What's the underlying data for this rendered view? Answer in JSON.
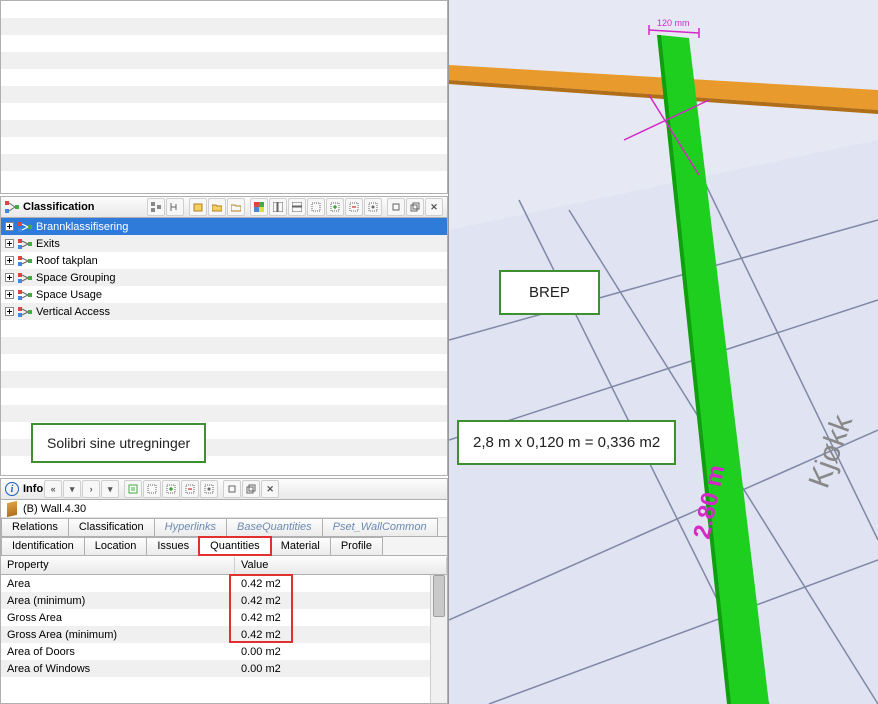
{
  "classification": {
    "title": "Classification",
    "items": [
      {
        "label": "Brannklassifisering",
        "selected": true
      },
      {
        "label": "Exits"
      },
      {
        "label": "Roof takplan"
      },
      {
        "label": "Space Grouping"
      },
      {
        "label": "Space Usage"
      },
      {
        "label": "Vertical Access"
      }
    ]
  },
  "callout_left": "Solibri sine utregninger",
  "info": {
    "title": "Info",
    "object": "(B) Wall.4.30",
    "tabs_row1": [
      {
        "label": "Relations"
      },
      {
        "label": "Classification"
      },
      {
        "label": "Hyperlinks",
        "disabled": true
      },
      {
        "label": "BaseQuantities",
        "disabled": true
      },
      {
        "label": "Pset_WallCommon",
        "disabled": true
      }
    ],
    "tabs_row2": [
      {
        "label": "Identification"
      },
      {
        "label": "Location"
      },
      {
        "label": "Issues"
      },
      {
        "label": "Quantities",
        "active": true
      },
      {
        "label": "Material"
      },
      {
        "label": "Profile"
      }
    ],
    "columns": {
      "prop": "Property",
      "val": "Value"
    },
    "rows": [
      {
        "prop": "Area",
        "val": "0.42 m2",
        "hl": true
      },
      {
        "prop": "Area (minimum)",
        "val": "0.42 m2",
        "hl": true
      },
      {
        "prop": "Gross Area",
        "val": "0.42 m2",
        "hl": true
      },
      {
        "prop": "Gross Area (minimum)",
        "val": "0.42 m2",
        "hl": true
      },
      {
        "prop": "Area of Doors",
        "val": "0.00 m2"
      },
      {
        "prop": "Area of Windows",
        "val": "0.00 m2"
      }
    ]
  },
  "viewport": {
    "brep_label": "BREP",
    "equation": "2,8 m x 0,120 m = 0,336 m2",
    "dim_height": "2.80 m",
    "dim_top": "120 mm",
    "room_label": "Kjøkk"
  }
}
